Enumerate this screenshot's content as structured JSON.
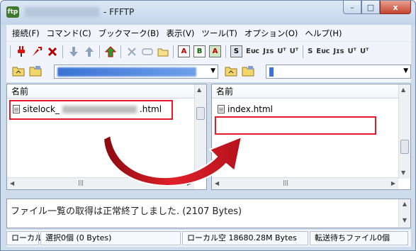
{
  "window": {
    "title": "- FFFTP",
    "app_icon_label": "ftp",
    "buttons": {
      "minimize": "–",
      "maximize": "□",
      "close": "x"
    }
  },
  "menu": [
    "接続(F)",
    "コマンド(C)",
    "ブックマーク(B)",
    "表示(V)",
    "ツール(T)",
    "オプション(O)",
    "ヘルプ(H)"
  ],
  "toolbar": {
    "text_buttons": [
      "S",
      "Eᴜᴄ",
      "Jɪs",
      "Uᵀ",
      "Uᵀ",
      "S",
      "Eᴜᴄ",
      "Jɪs",
      "Uᵀ",
      "Uᵀ"
    ],
    "box_buttons": [
      "A",
      "B",
      "A"
    ]
  },
  "local": {
    "header": "名前",
    "file_prefix": "sitelock_",
    "file_suffix": ".html"
  },
  "remote": {
    "header": "名前",
    "file_name": "index.html"
  },
  "log": {
    "message": "ファイル一覧の取得は正常終了しました. (2107 Bytes)"
  },
  "status": {
    "mode": "ローカル",
    "selection": "選択0個 (0 Bytes)",
    "local_free": "ローカル空 18680.28M Bytes",
    "queue": "転送待ちファイル0個"
  },
  "colors": {
    "highlight": "#e4192b",
    "titlebar": "#c3d4ea"
  }
}
